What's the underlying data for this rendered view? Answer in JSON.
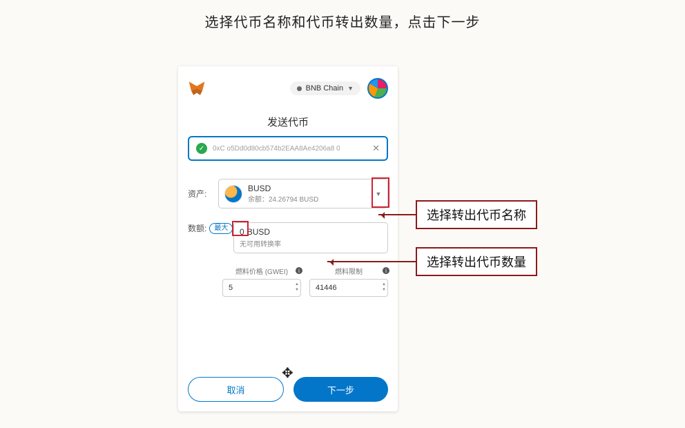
{
  "instruction": "选择代币名称和代币转出数量，点击下一步",
  "topbar": {
    "chain_label": "BNB Chain"
  },
  "send": {
    "title": "发送代币"
  },
  "address": {
    "value": "0xC                 o5Dd0d80cb574b2EAA8Ae4206a8        0"
  },
  "asset": {
    "label": "资产:",
    "token_symbol": "BUSD",
    "balance_label": "余额：",
    "balance_value": "24.26794 BUSD"
  },
  "amount": {
    "label": "数额:",
    "max_label": "最大",
    "value": "0",
    "unit": "BUSD",
    "sub": "无可用转换率"
  },
  "gas": {
    "price_label": "燃料价格 (GWEI)",
    "price_value": "5",
    "limit_label": "燃料限制",
    "limit_value": "41446"
  },
  "buttons": {
    "cancel": "取消",
    "next": "下一步"
  },
  "callouts": {
    "asset": "选择转出代币名称",
    "amount": "选择转出代币数量"
  }
}
